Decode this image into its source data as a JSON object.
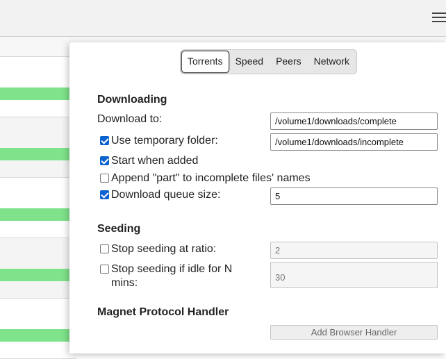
{
  "background_list": {
    "progress_color": "#7fe38b",
    "menu_icon": "hamburger-menu-icon"
  },
  "dialog": {
    "tabs": [
      {
        "label": "Torrents",
        "active": true
      },
      {
        "label": "Speed",
        "active": false
      },
      {
        "label": "Peers",
        "active": false
      },
      {
        "label": "Network",
        "active": false
      }
    ],
    "downloading": {
      "title": "Downloading",
      "download_to_label": "Download to:",
      "download_to_value": "/volume1/downloads/complete",
      "use_temp_folder_label": "Use temporary folder:",
      "use_temp_folder_checked": true,
      "temp_folder_value": "/volume1/downloads/incomplete",
      "start_when_added_label": "Start when added",
      "start_when_added_checked": true,
      "append_part_label": "Append \"part\" to incomplete files' names",
      "append_part_checked": false,
      "queue_size_label": "Download queue size:",
      "queue_size_checked": true,
      "queue_size_value": "5"
    },
    "seeding": {
      "title": "Seeding",
      "ratio_label": "Stop seeding at ratio:",
      "ratio_checked": false,
      "ratio_value": "2",
      "idle_label": "Stop seeding if idle for N mins:",
      "idle_checked": false,
      "idle_value": "30"
    },
    "magnet": {
      "title": "Magnet Protocol Handler",
      "button_label": "Add Browser Handler"
    }
  }
}
